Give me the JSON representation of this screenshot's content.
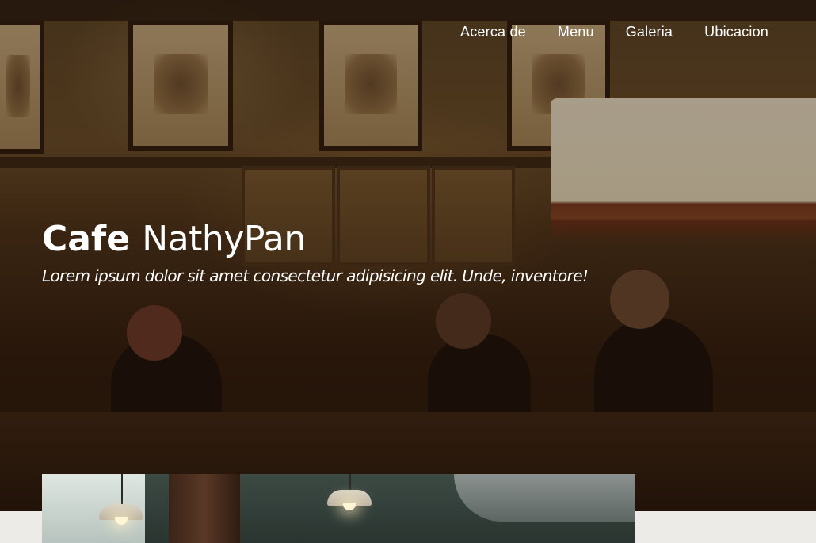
{
  "nav": {
    "items": [
      {
        "label": "Acerca de"
      },
      {
        "label": "Menu"
      },
      {
        "label": "Galeria"
      },
      {
        "label": "Ubicacion"
      }
    ]
  },
  "hero": {
    "title_bold": "Cafe",
    "title_light": "NathyPan",
    "tagline": "Lorem ipsum dolor sit amet consectetur adipisicing elit. Unde, inventore!"
  },
  "colors": {
    "text": "#ffffff",
    "hero_dark": "#25150a",
    "page_background": "#ecebe8"
  }
}
